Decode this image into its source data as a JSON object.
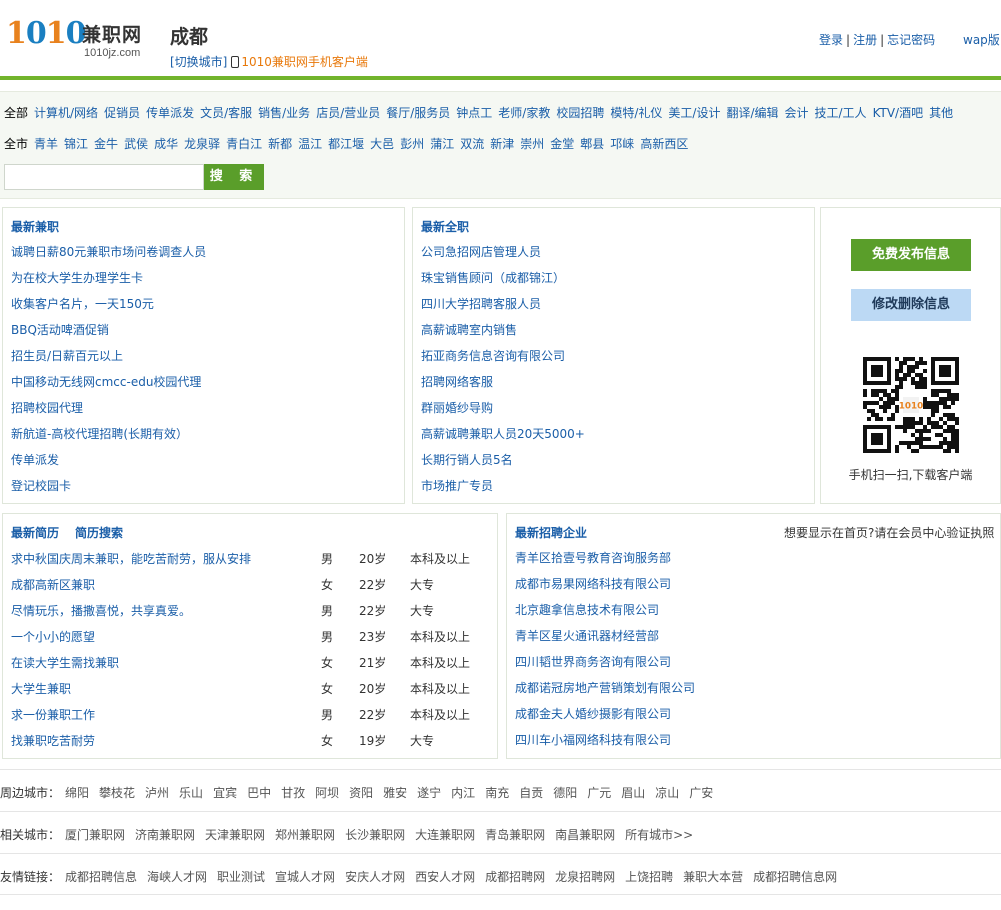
{
  "logo": {
    "digits_1": "1",
    "digits_0": "0",
    "digits_1b": "1",
    "digits_0b": "0",
    "cn": "兼职网",
    "domain": "1010jz.com"
  },
  "header": {
    "city": "成都",
    "switch_city": "[切换城市]",
    "mobile_client": "1010兼职网手机客户端",
    "login": "登录",
    "register": "注册",
    "forgot": "忘记密码",
    "wap": "wap版"
  },
  "filters": {
    "category_current": "全部",
    "categories": [
      "计算机/网络",
      "促销员",
      "传单派发",
      "文员/客服",
      "销售/业务",
      "店员/营业员",
      "餐厅/服务员",
      "钟点工",
      "老师/家教",
      "校园招聘",
      "模特/礼仪",
      "美工/设计",
      "翻译/编辑",
      "会计",
      "技工/工人",
      "KTV/酒吧",
      "其他"
    ],
    "district_current": "全市",
    "districts": [
      "青羊",
      "锦江",
      "金牛",
      "武侯",
      "成华",
      "龙泉驿",
      "青白江",
      "新都",
      "温江",
      "都江堰",
      "大邑",
      "彭州",
      "蒲江",
      "双流",
      "新津",
      "崇州",
      "金堂",
      "郫县",
      "邛崃",
      "高新西区"
    ],
    "search_value": "",
    "search_button": "搜 索"
  },
  "parttime": {
    "title": "最新兼职",
    "items": [
      "诚聘日薪80元兼职市场问卷调查人员",
      "为在校大学生办理学生卡",
      "收集客户名片，一天150元",
      "BBQ活动啤酒促销",
      "招生员/日薪百元以上",
      "中国移动无线网cmcc-edu校园代理",
      "招聘校园代理",
      "新航道-高校代理招聘(长期有效）",
      "传单派发",
      "登记校园卡"
    ]
  },
  "fulltime": {
    "title": "最新全职",
    "items": [
      "公司急招网店管理人员",
      "珠宝销售顾问（成都锦江）",
      "四川大学招聘客服人员",
      "高薪诚聘室内销售",
      "拓亚商务信息咨询有限公司",
      "招聘网络客服",
      "群丽婚纱导购",
      "高薪诚聘兼职人员20天5000+",
      "长期行销人员5名",
      "市场推广专员"
    ]
  },
  "side": {
    "publish": "免费发布信息",
    "modify": "修改删除信息",
    "qr_caption": "手机扫一扫,下载客户端",
    "qr_badge": "1010"
  },
  "resumes": {
    "title": "最新简历",
    "search": "简历搜索",
    "rows": [
      {
        "title": "求中秋国庆周末兼职，能吃苦耐劳，服从安排",
        "sex": "男",
        "age": "20岁",
        "edu": "本科及以上"
      },
      {
        "title": "成都高新区兼职",
        "sex": "女",
        "age": "22岁",
        "edu": "大专"
      },
      {
        "title": "尽情玩乐，播撒喜悦，共享真爱。",
        "sex": "男",
        "age": "22岁",
        "edu": "大专"
      },
      {
        "title": "一个小小的愿望",
        "sex": "男",
        "age": "23岁",
        "edu": "本科及以上"
      },
      {
        "title": "在读大学生需找兼职",
        "sex": "女",
        "age": "21岁",
        "edu": "本科及以上"
      },
      {
        "title": "大学生兼职",
        "sex": "女",
        "age": "20岁",
        "edu": "本科及以上"
      },
      {
        "title": "求一份兼职工作",
        "sex": "男",
        "age": "22岁",
        "edu": "本科及以上"
      },
      {
        "title": "找兼职吃苦耐劳",
        "sex": "女",
        "age": "19岁",
        "edu": "大专"
      }
    ]
  },
  "companies": {
    "title": "最新招聘企业",
    "note": "想要显示在首页?请在会员中心验证执照",
    "items": [
      "青羊区拾壹号教育咨询服务部",
      "成都市易果网络科技有限公司",
      "北京趣拿信息技术有限公司",
      "青羊区星火通讯器材经营部",
      "四川韬世界商务咨询有限公司",
      "成都诺冠房地产营销策划有限公司",
      "成都金夫人婚纱摄影有限公司",
      "四川车小福网络科技有限公司"
    ]
  },
  "footer": {
    "near_label": "周边城市：",
    "near": [
      "绵阳",
      "攀枝花",
      "泸州",
      "乐山",
      "宜宾",
      "巴中",
      "甘孜",
      "阿坝",
      "资阳",
      "雅安",
      "遂宁",
      "内江",
      "南充",
      "自贡",
      "德阳",
      "广元",
      "眉山",
      "凉山",
      "广安"
    ],
    "related_label": "相关城市：",
    "related": [
      "厦门兼职网",
      "济南兼职网",
      "天津兼职网",
      "郑州兼职网",
      "长沙兼职网",
      "大连兼职网",
      "青岛兼职网",
      "南昌兼职网",
      "所有城市>>"
    ],
    "friend_label": "友情链接：",
    "friend": [
      "成都招聘信息",
      "海峡人才网",
      "职业测试",
      "宣城人才网",
      "安庆人才网",
      "西安人才网",
      "成都招聘网",
      "龙泉招聘网",
      "上饶招聘",
      "兼职大本营",
      "成都招聘信息网"
    ]
  }
}
